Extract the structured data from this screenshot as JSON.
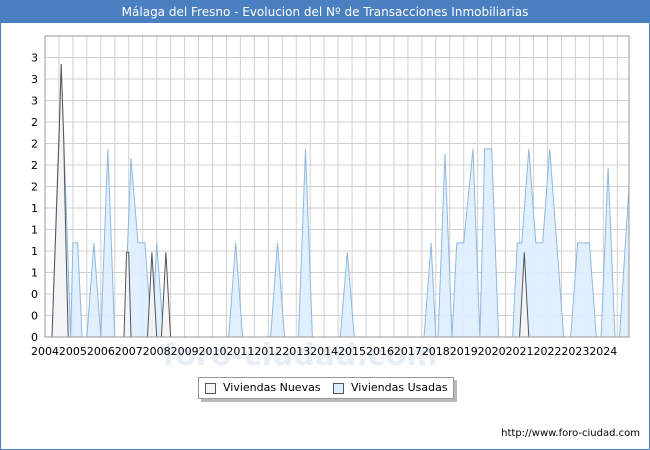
{
  "title": "Málaga del Fresno - Evolucion del Nº de Transacciones Inmobiliarias",
  "footer_url": "http://www.foro-ciudad.com",
  "colors": {
    "title_bg": "#4a7fc1",
    "nuevas_fill": "#f4f4f4",
    "nuevas_line": "#555555",
    "usadas_fill": "#ddeeff",
    "usadas_line": "#8fb8e0",
    "grid": "#d0d0d0"
  },
  "legend": {
    "nuevas_label": "Viviendas Nuevas",
    "usadas_label": "Viviendas Usadas"
  },
  "chart_data": {
    "type": "area",
    "title": "Málaga del Fresno - Evolucion del Nº de Transacciones Inmobiliarias",
    "xlabel": "",
    "ylabel": "",
    "x_range": [
      2004.0,
      2024.92
    ],
    "ylim": [
      0,
      3.2
    ],
    "y_tick_labels": [
      "0",
      "0",
      "0",
      "1",
      "1",
      "1",
      "1",
      "2",
      "2",
      "2",
      "2",
      "3",
      "3",
      "3"
    ],
    "x_tick_labels": [
      "2004",
      "2005",
      "2006",
      "2007",
      "2008",
      "2009",
      "2010",
      "2011",
      "2012",
      "2013",
      "2014",
      "2015",
      "2016",
      "2017",
      "2018",
      "2019",
      "2020",
      "2021",
      "2022",
      "2023",
      "2024"
    ],
    "grid": true,
    "legend_position": "bottom-center",
    "series": [
      {
        "name": "Viviendas Nuevas",
        "points": [
          [
            2004.25,
            0
          ],
          [
            2004.5,
            2.1
          ],
          [
            2004.58,
            2.9
          ],
          [
            2004.67,
            2.1
          ],
          [
            2004.75,
            1.0
          ],
          [
            2004.83,
            0
          ],
          [
            2006.83,
            0
          ],
          [
            2006.92,
            0.9
          ],
          [
            2007.0,
            0.9
          ],
          [
            2007.08,
            0
          ],
          [
            2007.67,
            0
          ],
          [
            2007.83,
            0.9
          ],
          [
            2008.0,
            0
          ],
          [
            2008.17,
            0
          ],
          [
            2008.33,
            0.9
          ],
          [
            2008.5,
            0
          ],
          [
            2021.0,
            0
          ],
          [
            2021.17,
            0.9
          ],
          [
            2021.33,
            0
          ]
        ]
      },
      {
        "name": "Viviendas Usadas",
        "points": [
          [
            2004.25,
            0
          ],
          [
            2004.58,
            2.9
          ],
          [
            2004.92,
            0
          ],
          [
            2005.0,
            1.0
          ],
          [
            2005.17,
            1.0
          ],
          [
            2005.33,
            0
          ],
          [
            2005.5,
            0
          ],
          [
            2005.75,
            1.0
          ],
          [
            2006.0,
            0
          ],
          [
            2006.25,
            2.0
          ],
          [
            2006.5,
            0
          ],
          [
            2006.83,
            0
          ],
          [
            2007.08,
            1.9
          ],
          [
            2007.33,
            1.0
          ],
          [
            2007.58,
            1.0
          ],
          [
            2007.83,
            0
          ],
          [
            2008.0,
            1.0
          ],
          [
            2008.25,
            0
          ],
          [
            2008.58,
            0
          ],
          [
            2009.0,
            0
          ],
          [
            2010.58,
            0
          ],
          [
            2010.83,
            1.0
          ],
          [
            2011.08,
            0
          ],
          [
            2012.08,
            0
          ],
          [
            2012.33,
            1.0
          ],
          [
            2012.58,
            0
          ],
          [
            2013.08,
            0
          ],
          [
            2013.33,
            2.0
          ],
          [
            2013.58,
            0
          ],
          [
            2014.58,
            0
          ],
          [
            2014.83,
            0.9
          ],
          [
            2015.08,
            0
          ],
          [
            2017.58,
            0
          ],
          [
            2017.83,
            1.0
          ],
          [
            2018.0,
            0
          ],
          [
            2018.08,
            0
          ],
          [
            2018.33,
            1.95
          ],
          [
            2018.58,
            0
          ],
          [
            2018.75,
            1.0
          ],
          [
            2019.0,
            1.0
          ],
          [
            2019.33,
            2.0
          ],
          [
            2019.58,
            0
          ],
          [
            2019.75,
            2.0
          ],
          [
            2020.0,
            2.0
          ],
          [
            2020.25,
            0
          ],
          [
            2020.75,
            0
          ],
          [
            2020.92,
            1.0
          ],
          [
            2021.08,
            1.0
          ],
          [
            2021.33,
            2.0
          ],
          [
            2021.58,
            1.0
          ],
          [
            2021.83,
            1.0
          ],
          [
            2022.08,
            2.0
          ],
          [
            2022.33,
            1.0
          ],
          [
            2022.58,
            0
          ],
          [
            2022.83,
            0
          ],
          [
            2023.08,
            1.0
          ],
          [
            2023.5,
            1.0
          ],
          [
            2023.75,
            0
          ],
          [
            2023.92,
            0
          ],
          [
            2024.17,
            1.8
          ],
          [
            2024.42,
            0
          ],
          [
            2024.58,
            0
          ],
          [
            2024.92,
            1.6
          ]
        ]
      }
    ]
  }
}
